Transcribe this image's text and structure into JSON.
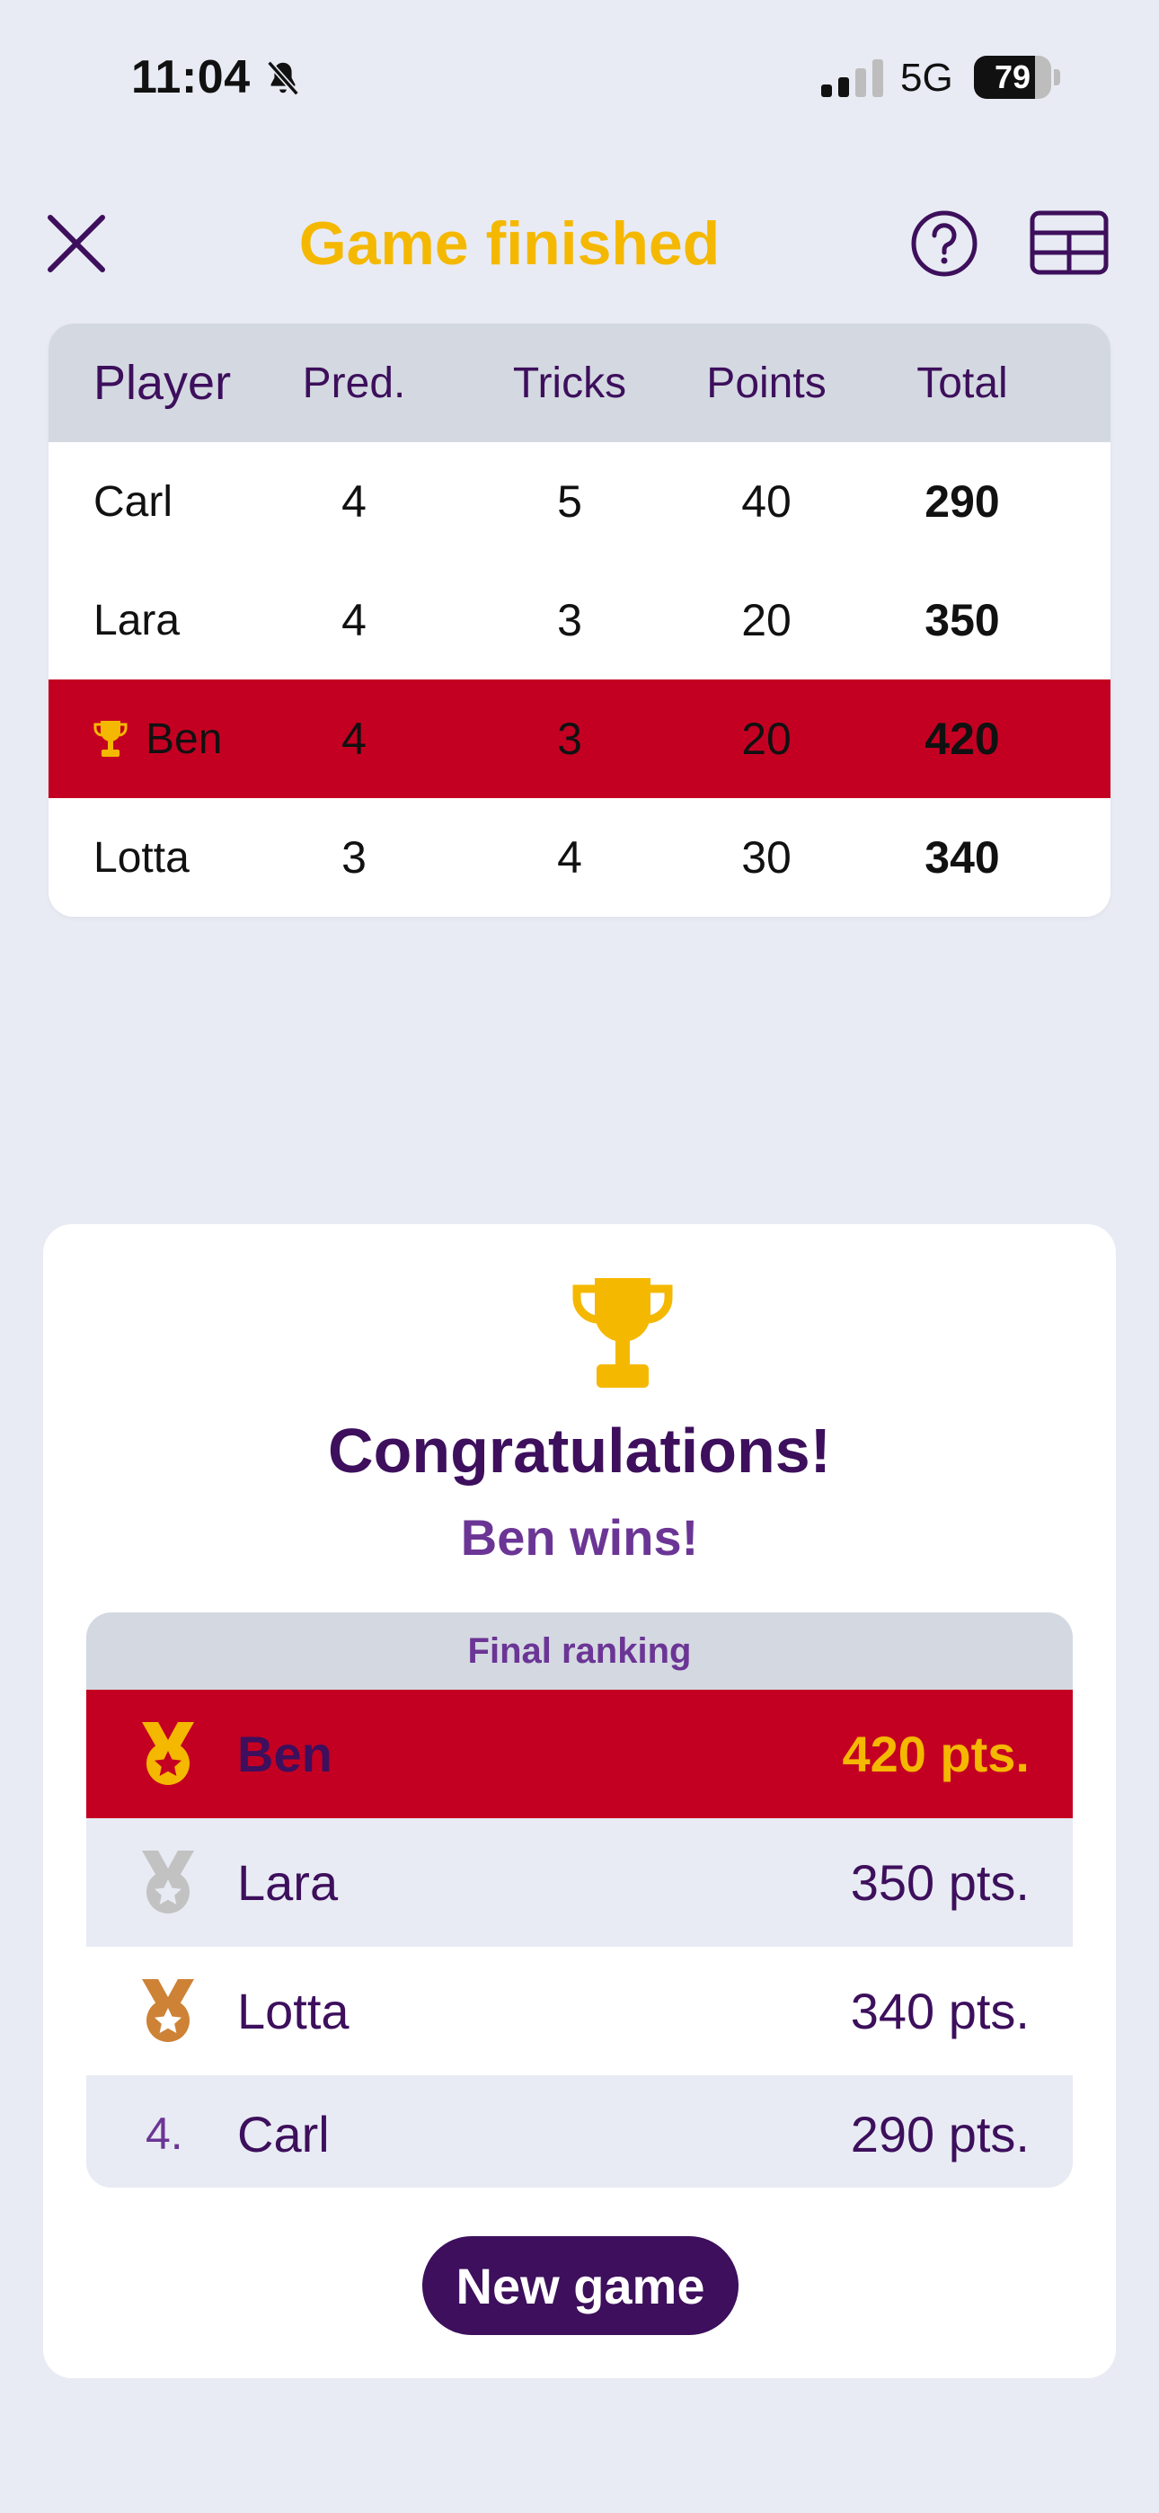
{
  "status_bar": {
    "time": "11:04",
    "network": "5G",
    "battery_level": "79",
    "battery_fraction": 0.79
  },
  "header": {
    "title": "Game finished",
    "close_icon": "close-icon",
    "help_icon": "help-icon",
    "table_icon": "table-icon"
  },
  "score_table": {
    "headers": [
      "Player",
      "Pred.",
      "Tricks",
      "Points",
      "Total"
    ],
    "rows": [
      {
        "player": "Carl",
        "pred": "4",
        "tricks": "5",
        "points": "40",
        "total": "290"
      },
      {
        "player": "Lara",
        "pred": "4",
        "tricks": "3",
        "points": "20",
        "total": "350"
      },
      {
        "player": "Ben",
        "pred": "4",
        "tricks": "3",
        "points": "20",
        "total": "420"
      },
      {
        "player": "Lotta",
        "pred": "3",
        "tricks": "4",
        "points": "30",
        "total": "340"
      }
    ]
  },
  "congrats": {
    "title": "Congratulations!",
    "winner_text": "Ben wins!"
  },
  "ranking": {
    "header": "Final ranking",
    "entries": [
      {
        "medal": "gold-medal-icon",
        "rank": "",
        "name": "Ben",
        "points": "420 pts."
      },
      {
        "medal": "silver-medal-icon",
        "rank": "",
        "name": "Lara",
        "points": "350 pts."
      },
      {
        "medal": "bronze-medal-icon",
        "rank": "",
        "name": "Lotta",
        "points": "340 pts."
      },
      {
        "medal": "",
        "rank": "4.",
        "name": "Carl",
        "points": "290 pts."
      }
    ]
  },
  "actions": {
    "new_game": "New game"
  },
  "colors": {
    "accent_yellow": "#f5b800",
    "primary_purple": "#3d0f5c",
    "winner_red": "#c40022",
    "background": "#e8ebf3"
  }
}
